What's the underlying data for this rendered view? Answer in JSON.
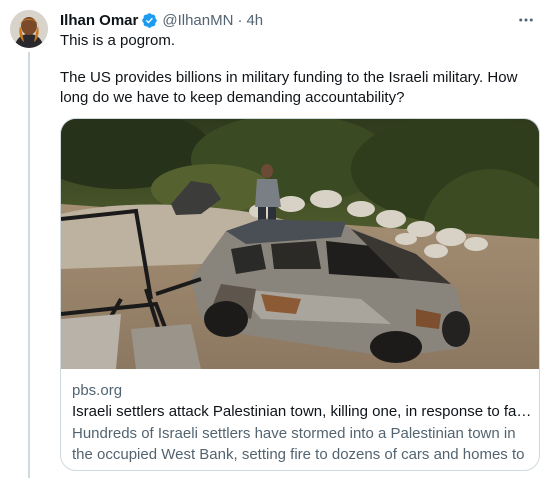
{
  "tweet": {
    "author_name": "Ilhan Omar",
    "handle": "@IlhanMN",
    "separator": "·",
    "time": "4h",
    "line1": "This is a pogrom.",
    "line2": "The US provides billions in military funding to the Israeli military. How long do we have to keep demanding accountability?"
  },
  "link_card": {
    "domain": "pbs.org",
    "title": "Israeli settlers attack Palestinian town, killing one, in response to fata...",
    "description": "Hundreds of Israeli settlers have stormed into a Palestinian town in the occupied West Bank, setting fire to dozens of cars and homes to ..."
  },
  "icons": {
    "verified": "verified-badge-icon",
    "more": "more-options-icon"
  },
  "colors": {
    "verified_blue": "#1d9bf0",
    "secondary_text": "#536471",
    "border": "#cfd9de"
  }
}
